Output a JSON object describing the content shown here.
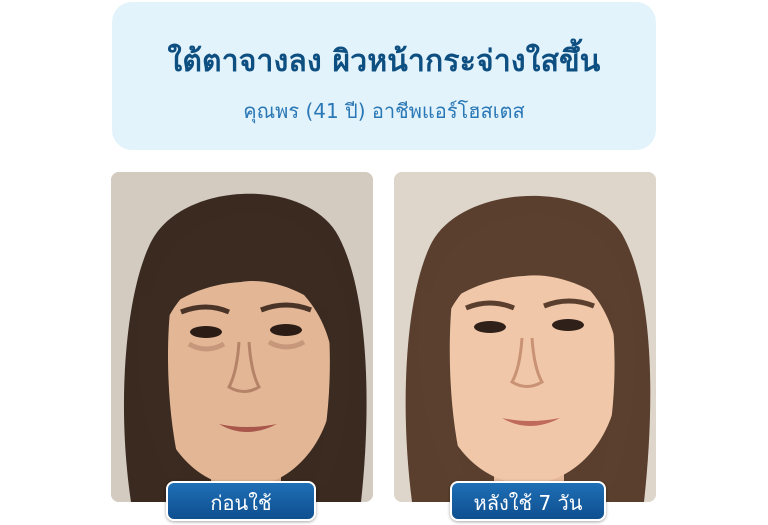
{
  "header": {
    "headline": "ใต้ตาจางลง ผิวหน้ากระจ่างใสขึ้น",
    "subline": "คุณพร (41 ปี) อาชีพแอร์โฮสเตส"
  },
  "photos": {
    "before_label": "ก่อนใช้",
    "after_label": "หลังใช้ 7 วัน"
  },
  "colors": {
    "header_bg": "#e3f3fb",
    "headline": "#0e4f82",
    "subline": "#2a78b6",
    "label_bg": "#15599b"
  }
}
